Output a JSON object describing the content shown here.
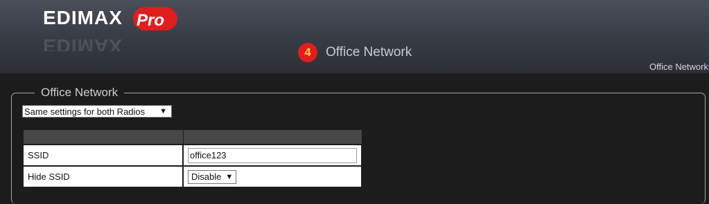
{
  "brand": {
    "wordmark": "EDIMAX",
    "badge": "Pro"
  },
  "wizard": {
    "step_number": "4",
    "step_title": "Office Network"
  },
  "breadcrumb": "Office Network",
  "section": {
    "legend": "Office Network",
    "radio_mode": {
      "selected": "Same settings for both Radios",
      "caret": "▼"
    },
    "table": {
      "headers": [
        "",
        ""
      ],
      "rows": [
        {
          "label": "SSID",
          "value": "office123"
        },
        {
          "label": "Hide SSID",
          "value": "Disable",
          "caret": "▼"
        }
      ]
    }
  },
  "colors": {
    "header_top": "#4a4f5a",
    "background": "#1c1c1c",
    "brand_red": "#e01e1e",
    "step_number": "#ffd23a"
  }
}
